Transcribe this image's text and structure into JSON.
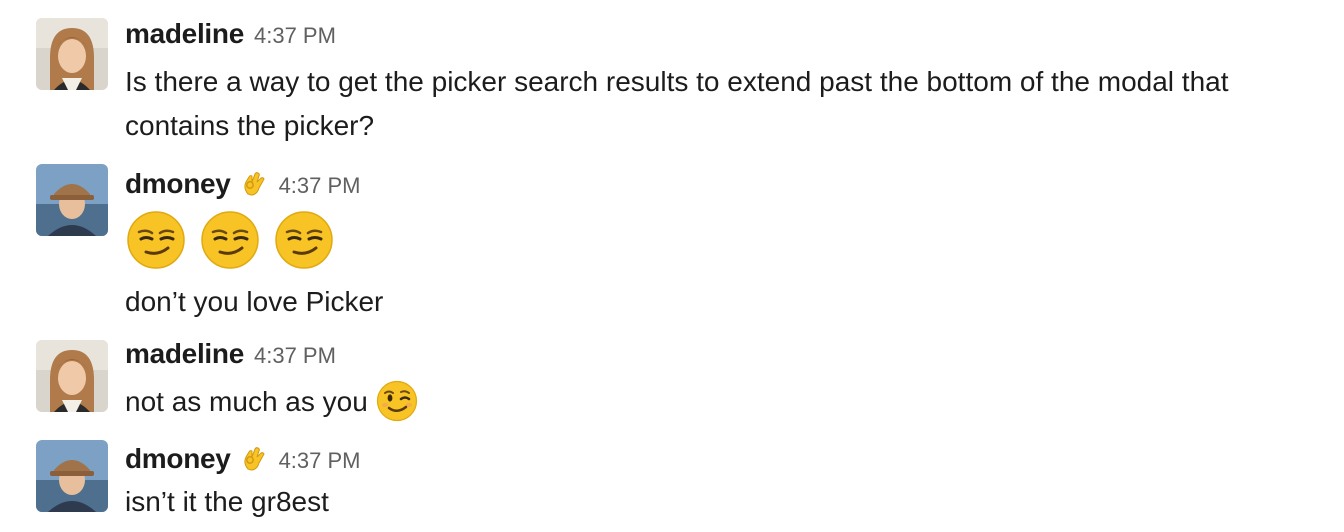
{
  "messages": [
    {
      "user": "madeline",
      "time": "4:37 PM",
      "avatar_icon": "madeline-avatar",
      "text_lines": [
        "Is there a way to get the picker search results to extend past the bottom of the modal that",
        "contains the picker?"
      ]
    },
    {
      "user": "dmoney",
      "time": "4:37 PM",
      "avatar_icon": "dmoney-avatar",
      "status_emoji": "ok-hand-icon",
      "emojis": [
        "smirk-face-icon",
        "smirk-face-icon",
        "smirk-face-icon"
      ],
      "text": "don’t you love Picker"
    },
    {
      "user": "madeline",
      "time": "4:37 PM",
      "avatar_icon": "madeline-avatar",
      "text": "not as much as you",
      "trailing_emoji": "wink-face-icon"
    },
    {
      "user": "dmoney",
      "time": "4:37 PM",
      "avatar_icon": "dmoney-avatar",
      "status_emoji": "ok-hand-icon",
      "text": "isn’t it the gr8est"
    }
  ],
  "colors": {
    "text": "#1d1c1d",
    "timestamp": "#616061",
    "emoji_yellow": "#f7c325"
  }
}
